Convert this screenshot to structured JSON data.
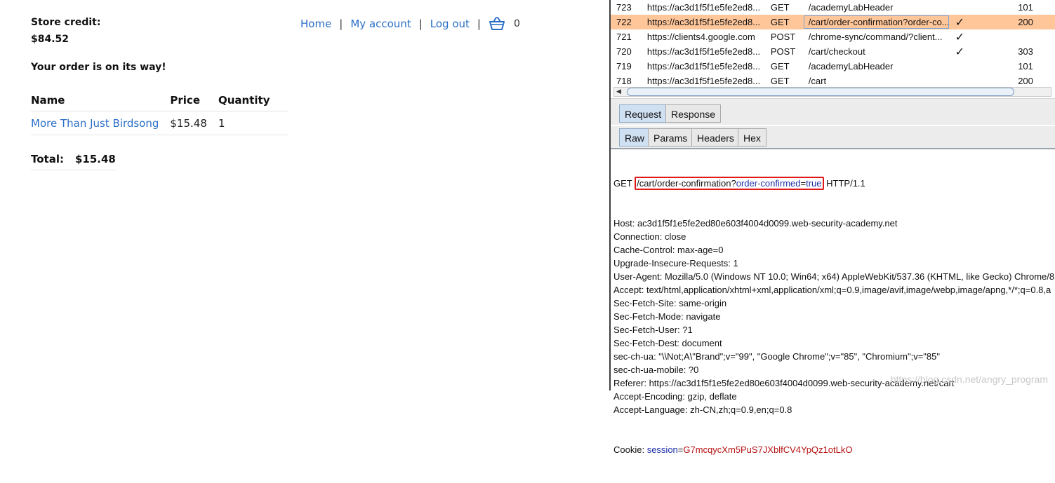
{
  "shop": {
    "store_credit_label": "Store credit:",
    "store_credit_value": "$84.52",
    "order_message": "Your order is on its way!",
    "nav": {
      "home": "Home",
      "my_account": "My account",
      "log_out": "Log out",
      "cart_count": "0"
    },
    "table": {
      "headers": [
        "Name",
        "Price",
        "Quantity"
      ],
      "rows": [
        {
          "name": "More Than Just Birdsong",
          "price": "$15.48",
          "quantity": "1"
        }
      ]
    },
    "total_label": "Total:",
    "total_value": "$15.48"
  },
  "proxy": {
    "history": [
      {
        "num": "723",
        "host": "https://ac3d1f5f1e5fe2ed8...",
        "method": "GET",
        "url": "/academyLabHeader",
        "edited": "",
        "status": "101"
      },
      {
        "num": "722",
        "host": "https://ac3d1f5f1e5fe2ed8...",
        "method": "GET",
        "url": "/cart/order-confirmation?order-co...",
        "edited": "✓",
        "status": "200"
      },
      {
        "num": "721",
        "host": "https://clients4.google.com",
        "method": "POST",
        "url": "/chrome-sync/command/?client...",
        "edited": "✓",
        "status": ""
      },
      {
        "num": "720",
        "host": "https://ac3d1f5f1e5fe2ed8...",
        "method": "POST",
        "url": "/cart/checkout",
        "edited": "✓",
        "status": "303"
      },
      {
        "num": "719",
        "host": "https://ac3d1f5f1e5fe2ed8...",
        "method": "GET",
        "url": "/academyLabHeader",
        "edited": "",
        "status": "101"
      },
      {
        "num": "718",
        "host": "https://ac3d1f5f1e5fe2ed8...",
        "method": "GET",
        "url": "/cart",
        "edited": "",
        "status": "200"
      }
    ],
    "tabs": [
      "Request",
      "Response"
    ],
    "subtabs": [
      "Raw",
      "Params",
      "Headers",
      "Hex"
    ],
    "request": {
      "method": "GET",
      "path": "/cart/order-confirmation?",
      "param_name": "order-confirmed",
      "param_eq": "=",
      "param_value": "true",
      "protocol": "HTTP/1.1",
      "headers": [
        "Host: ac3d1f5f1e5fe2ed80e603f4004d0099.web-security-academy.net",
        "Connection: close",
        "Cache-Control: max-age=0",
        "Upgrade-Insecure-Requests: 1",
        "User-Agent: Mozilla/5.0 (Windows NT 10.0; Win64; x64) AppleWebKit/537.36 (KHTML, like Gecko) Chrome/8",
        "Accept: text/html,application/xhtml+xml,application/xml;q=0.9,image/avif,image/webp,image/apng,*/*;q=0.8,a",
        "Sec-Fetch-Site: same-origin",
        "Sec-Fetch-Mode: navigate",
        "Sec-Fetch-User: ?1",
        "Sec-Fetch-Dest: document",
        "sec-ch-ua: \"\\\\Not;A\\\"Brand\";v=\"99\", \"Google Chrome\";v=\"85\", \"Chromium\";v=\"85\"",
        "sec-ch-ua-mobile: ?0",
        "Referer: https://ac3d1f5f1e5fe2ed80e603f4004d0099.web-security-academy.net/cart",
        "Accept-Encoding: gzip, deflate",
        "Accept-Language: zh-CN,zh;q=0.9,en;q=0.8"
      ],
      "cookie_label": "Cookie: ",
      "cookie_name": "session",
      "cookie_eq": "=",
      "cookie_value": "G7mcqycXm5PuS7JXblfCV4YpQz1otLkO"
    },
    "watermark": "https://blog.csdn.net/angry_program"
  }
}
